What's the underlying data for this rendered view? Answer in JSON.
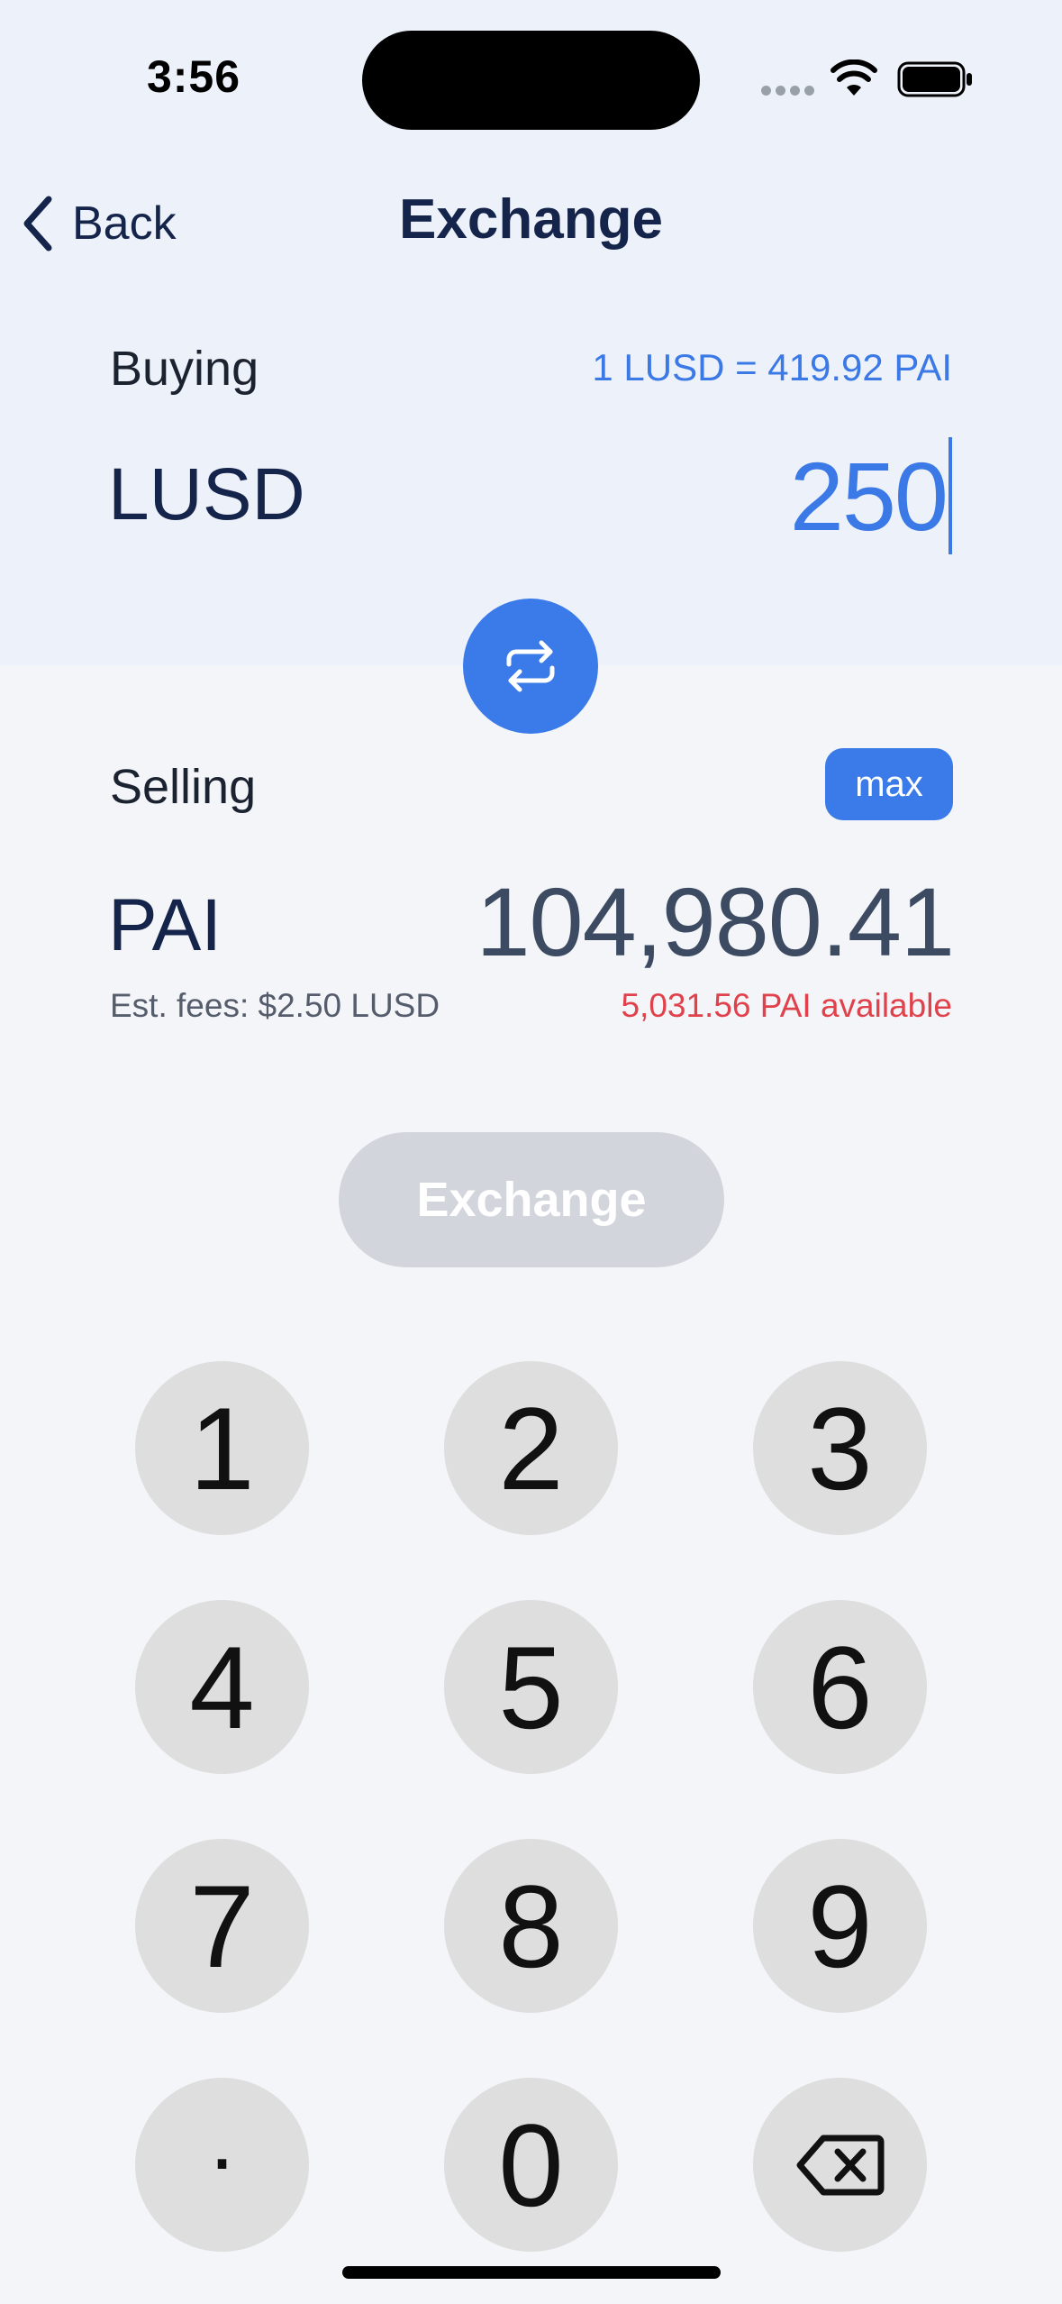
{
  "status_bar": {
    "time": "3:56",
    "icons": [
      "cellular-signal-icon",
      "wifi-icon",
      "battery-icon"
    ]
  },
  "nav": {
    "back_label": "Back",
    "title": "Exchange",
    "back_icon": "chevron-left-icon"
  },
  "buying": {
    "label": "Buying",
    "rate": "1 LUSD = 419.92 PAI",
    "currency": "LUSD",
    "amount": "250"
  },
  "swap": {
    "icon": "swap-arrows-icon"
  },
  "selling": {
    "label": "Selling",
    "max_label": "max",
    "currency": "PAI",
    "amount": "104,980.41",
    "fees": "Est. fees: $2.50 LUSD",
    "available": "5,031.56 PAI available"
  },
  "exchange_button": {
    "label": "Exchange",
    "enabled": false
  },
  "keypad": {
    "keys": [
      "1",
      "2",
      "3",
      "4",
      "5",
      "6",
      "7",
      "8",
      "9",
      ".",
      "0"
    ],
    "delete_icon": "backspace-icon"
  },
  "colors": {
    "accent": "#3a7be9",
    "error": "#e0414b",
    "top_background": "#edf1fa",
    "page_background": "#f4f5f8",
    "key_background": "#dedede",
    "disabled_button": "#d2d5dc"
  }
}
